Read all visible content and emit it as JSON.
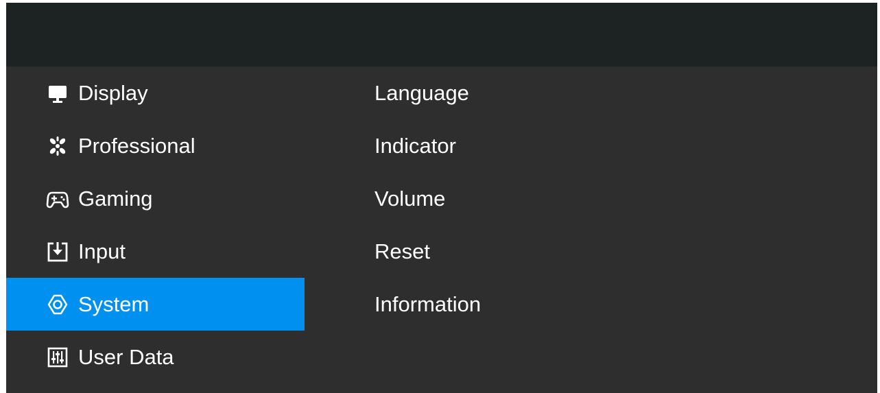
{
  "sidebar": {
    "items": [
      {
        "label": "Display",
        "icon": "monitor-icon",
        "active": false
      },
      {
        "label": "Professional",
        "icon": "flower-pattern-icon",
        "active": false
      },
      {
        "label": "Gaming",
        "icon": "gamepad-icon",
        "active": false
      },
      {
        "label": "Input",
        "icon": "input-arrow-icon",
        "active": false
      },
      {
        "label": "System",
        "icon": "gear-icon",
        "active": true
      },
      {
        "label": "User Data",
        "icon": "sliders-icon",
        "active": false
      }
    ]
  },
  "submenu": {
    "items": [
      {
        "label": "Language"
      },
      {
        "label": "Indicator"
      },
      {
        "label": "Volume"
      },
      {
        "label": "Reset"
      },
      {
        "label": "Information"
      }
    ]
  },
  "colors": {
    "header_bg": "#1d2223",
    "panel_bg": "#2e2e2e",
    "active_bg": "#0091f0",
    "text": "#ffffff"
  }
}
